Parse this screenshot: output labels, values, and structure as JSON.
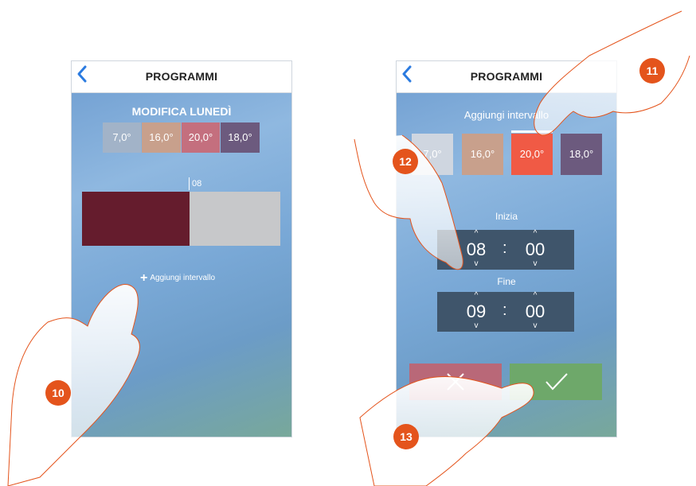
{
  "left_screen": {
    "nav": {
      "title": "PROGRAMMI"
    },
    "section_title": "MODIFICA LUNEDÌ",
    "temperatures": [
      {
        "label": "7,0°",
        "color": "#a2b3c8"
      },
      {
        "label": "16,0°",
        "color": "#c8a08c"
      },
      {
        "label": "20,0°",
        "color": "#c46f7e"
      },
      {
        "label": "18,0°",
        "color": "#6c5a7e"
      }
    ],
    "timeline": {
      "marker_label": "08",
      "first_color": "#651c2d",
      "second_color": "#c7c8ca"
    },
    "add_interval_label": "Aggiungi intervallo"
  },
  "right_screen": {
    "nav": {
      "title": "PROGRAMMI"
    },
    "section_title": "Aggiungi intervallo",
    "temperatures": [
      {
        "label": "7,0°",
        "color": "#cfd6e0"
      },
      {
        "label": "16,0°",
        "color": "#c8a08c"
      },
      {
        "label": "20,0°",
        "color": "#f05a45",
        "selected": true
      },
      {
        "label": "18,0°",
        "color": "#6c5a7e"
      }
    ],
    "start": {
      "label": "Inizia",
      "hours": "08",
      "minutes": "00"
    },
    "end": {
      "label": "Fine",
      "hours": "09",
      "minutes": "00"
    },
    "cancel_icon": "close-icon",
    "confirm_icon": "check-icon",
    "cancel_color": "#b96878",
    "confirm_color": "#6ea86a"
  },
  "callouts": [
    "10",
    "11",
    "12",
    "13"
  ],
  "accent_color": "#e4541c"
}
